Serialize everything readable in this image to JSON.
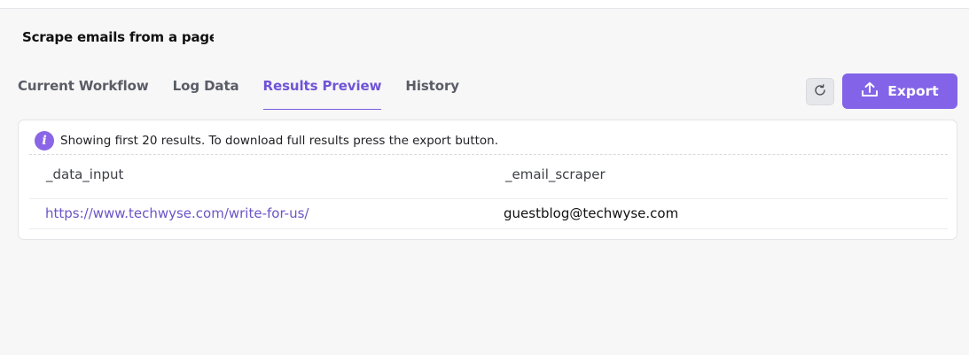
{
  "page": {
    "title": "Scrape emails from a page"
  },
  "tabs": [
    {
      "label": "Current Workflow",
      "active": false
    },
    {
      "label": "Log Data",
      "active": false
    },
    {
      "label": "Results Preview",
      "active": true
    },
    {
      "label": "History",
      "active": false
    }
  ],
  "toolbar": {
    "refresh_icon": "refresh-icon",
    "export_label": "Export",
    "export_icon": "upload-icon"
  },
  "notice": {
    "icon": "info-icon",
    "text": "Showing first 20 results. To download full results press the export button."
  },
  "table": {
    "columns": [
      "_data_input",
      "_email_scraper"
    ],
    "rows": [
      [
        "https://www.techwyse.com/write-for-us/",
        "guestblog@techwyse.com"
      ]
    ]
  },
  "colors": {
    "accent": "#8364e8",
    "active_tab": "#7054d6",
    "link": "#6b55c6"
  }
}
